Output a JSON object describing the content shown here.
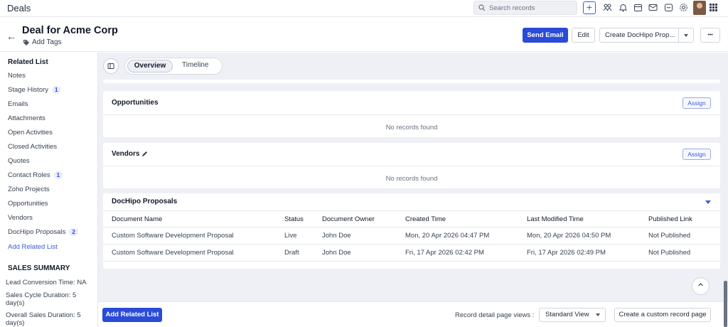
{
  "topbar": {
    "title": "Deals",
    "search_placeholder": "Search records",
    "plus_label": "+",
    "icons": [
      "plus-icon",
      "people-icon",
      "bell-icon",
      "calendar-icon",
      "mail-icon",
      "store-icon",
      "gear-icon",
      "avatar",
      "apps-grid-icon"
    ]
  },
  "header": {
    "title": "Deal for Acme Corp",
    "add_tags": "Add Tags",
    "send_email": "Send Email",
    "edit": "Edit",
    "create_docs": "Create DocHipo Prop...",
    "more": "•••"
  },
  "sidebar": {
    "heading": "Related List",
    "items": [
      {
        "label": "Notes",
        "badge": ""
      },
      {
        "label": "Stage History",
        "badge": "1"
      },
      {
        "label": "Emails",
        "badge": ""
      },
      {
        "label": "Attachments",
        "badge": ""
      },
      {
        "label": "Open Activities",
        "badge": ""
      },
      {
        "label": "Closed Activities",
        "badge": ""
      },
      {
        "label": "Quotes",
        "badge": ""
      },
      {
        "label": "Contact Roles",
        "badge": "1"
      },
      {
        "label": "Zoho Projects",
        "badge": ""
      },
      {
        "label": "Opportunities",
        "badge": ""
      },
      {
        "label": "Vendors",
        "badge": ""
      },
      {
        "label": "DocHipo Proposals",
        "badge": "2"
      }
    ],
    "add_related": "Add Related List",
    "summary_heading": "SALES SUMMARY",
    "lead_conversion": "Lead Conversion Time: NA",
    "sales_cycle": "Sales Cycle Duration: 5 day(s)",
    "overall_sales": "Overall Sales Duration: 5 day(s)"
  },
  "tabs": {
    "overview": "Overview",
    "timeline": "Timeline"
  },
  "opportunities": {
    "title": "Opportunities",
    "assign": "Assign",
    "empty": "No records found"
  },
  "vendors": {
    "title": "Vendors",
    "assign": "Assign",
    "empty": "No records found"
  },
  "dochipo": {
    "title": "DocHipo Proposals",
    "columns": [
      "Document Name",
      "Status",
      "Document Owner",
      "Created Time",
      "Last Modified Time",
      "Published Link"
    ],
    "rows": [
      [
        "Custom Software Development Proposal",
        "Live",
        "John Doe",
        "Mon, 20 Apr 2026 04:47 PM",
        "Mon, 20 Apr 2026 04:50 PM",
        "Not Published"
      ],
      [
        "Custom Software Development Proposal",
        "Draft",
        "John Doe",
        "Fri, 17 Apr 2026 02:42 PM",
        "Fri, 17 Apr 2026 02:49 PM",
        "Not Published"
      ]
    ]
  },
  "footer": {
    "add_related": "Add Related List",
    "views_label": "Record detail page views :",
    "view_selected": "Standard View",
    "create_custom": "Create a custom record page"
  },
  "colors": {
    "accent": "#2a4bd7",
    "content_bg": "#eef0f6"
  }
}
